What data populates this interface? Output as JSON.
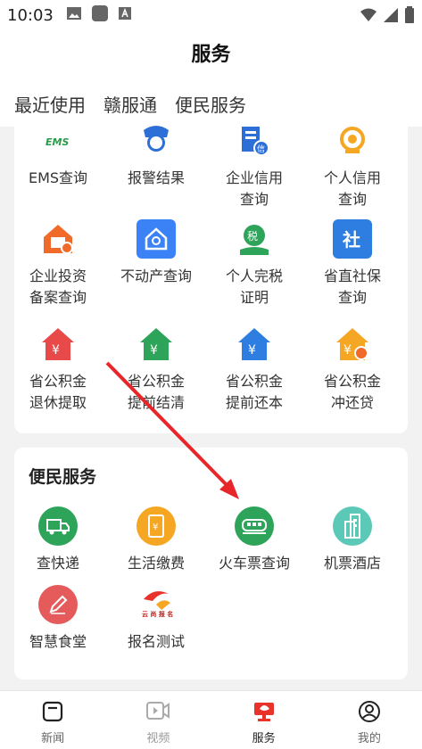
{
  "status_bar": {
    "time": "10:03"
  },
  "header": {
    "title": "服务"
  },
  "tabs": [
    "最近使用",
    "赣服通",
    "便民服务"
  ],
  "top_grid": [
    {
      "label": "EMS查询",
      "icon": "ems-icon"
    },
    {
      "label": "报警结果",
      "icon": "police-icon"
    },
    {
      "label": "企业信用\n查询",
      "icon": "enterprise-credit-icon"
    },
    {
      "label": "个人信用\n查询",
      "icon": "personal-credit-icon"
    },
    {
      "label": "企业投资\n备案查询",
      "icon": "enterprise-investment-icon"
    },
    {
      "label": "不动产查询",
      "icon": "real-estate-icon"
    },
    {
      "label": "个人完税\n证明",
      "icon": "tax-icon"
    },
    {
      "label": "省直社保\n查询",
      "icon": "social-security-icon"
    },
    {
      "label": "省公积金\n退休提取",
      "icon": "fund-house-icon"
    },
    {
      "label": "省公积金\n提前结清",
      "icon": "fund-house-icon"
    },
    {
      "label": "省公积金\n提前还本",
      "icon": "fund-house-icon"
    },
    {
      "label": "省公积金\n冲还贷",
      "icon": "fund-house-icon"
    }
  ],
  "convenience": {
    "title": "便民服务",
    "items": [
      {
        "label": "查快递",
        "icon": "truck-icon",
        "color": "#2ea35a"
      },
      {
        "label": "生活缴费",
        "icon": "phone-bill-icon",
        "color": "#f5a623"
      },
      {
        "label": "火车票查询",
        "icon": "train-icon",
        "color": "#2ea35a"
      },
      {
        "label": "机票酒店",
        "icon": "building-icon",
        "color": "#5cc8b8"
      },
      {
        "label": "智慧食堂",
        "icon": "pen-icon",
        "color": "#e55a5a"
      },
      {
        "label": "报名测试",
        "icon": "signup-logo-icon",
        "color": "#ffffff"
      }
    ]
  },
  "bottom_nav": [
    {
      "label": "新闻",
      "icon": "news-icon"
    },
    {
      "label": "视频",
      "icon": "video-icon"
    },
    {
      "label": "服务",
      "icon": "service-icon"
    },
    {
      "label": "我的",
      "icon": "profile-icon"
    }
  ]
}
